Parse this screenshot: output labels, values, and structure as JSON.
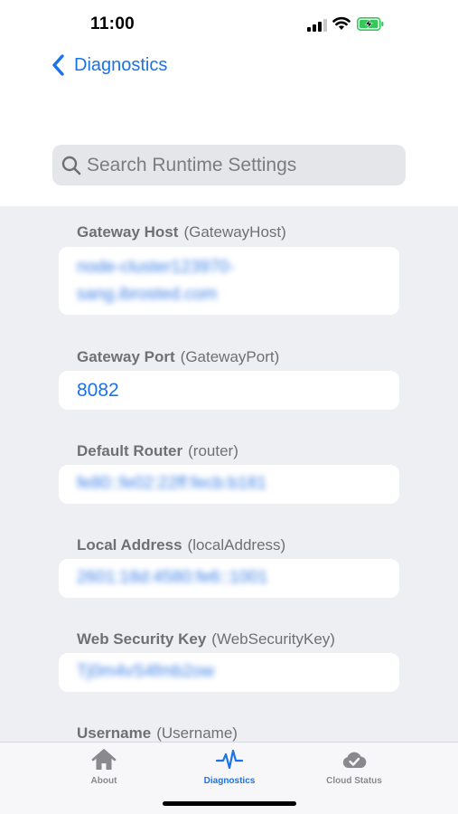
{
  "status_bar": {
    "time": "11:00"
  },
  "nav": {
    "back_label": "Diagnostics"
  },
  "search": {
    "placeholder": "Search Runtime Settings"
  },
  "settings": [
    {
      "name": "Gateway Host",
      "key": "(GatewayHost)",
      "value_line1": "node-cluster123970-",
      "value_line2": "sang.ibrosted.com"
    },
    {
      "name": "Gateway Port",
      "key": "(GatewayPort)",
      "value": "8082"
    },
    {
      "name": "Default Router",
      "key": "(router)",
      "value": "fe80::fe02:22ff:fecb:b181"
    },
    {
      "name": "Local Address",
      "key": "(localAddress)",
      "value": "2601:18d:4580:fe6::1001"
    },
    {
      "name": "Web Security Key",
      "key": "(WebSecurityKey)",
      "value": "Tj0m4vS4fmb2ow"
    },
    {
      "name": "Username",
      "key": "(Username)"
    }
  ],
  "tabs": [
    {
      "label": "About",
      "icon": "home-icon",
      "active": false
    },
    {
      "label": "Diagnostics",
      "icon": "pulse-icon",
      "active": true
    },
    {
      "label": "Cloud Status",
      "icon": "cloud-check-icon",
      "active": false
    }
  ],
  "colors": {
    "accent": "#1a73e8",
    "battery": "#34c759",
    "content_bg": "#eeeff3"
  }
}
